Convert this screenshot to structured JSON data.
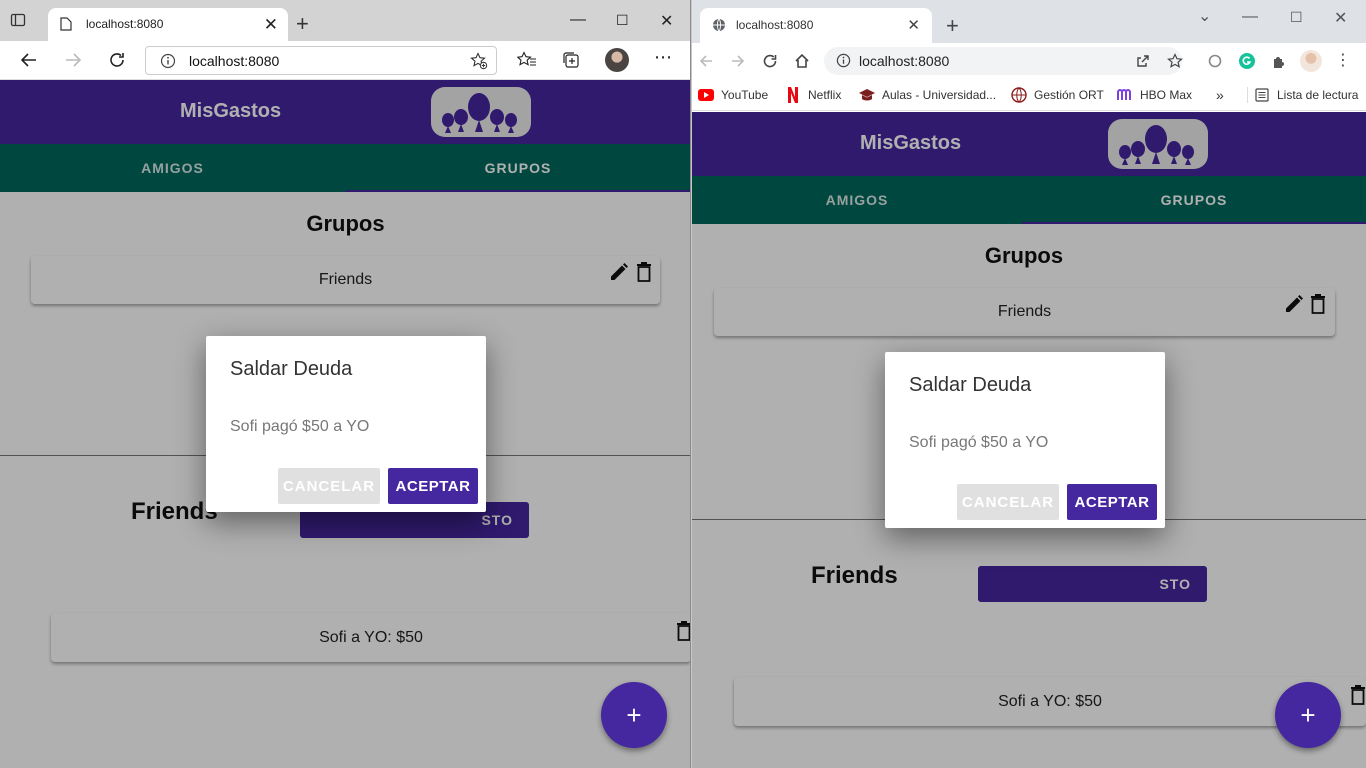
{
  "colors": {
    "primary": "#4527a0",
    "tabs_bar": "#00695c",
    "overlay": "rgba(0,0,0,0.31)"
  },
  "left_window": {
    "browser": "Edge",
    "tab_title": "localhost:8080",
    "url": "localhost:8080",
    "icons": [
      "tab-actions-icon",
      "page-icon",
      "close-icon",
      "new-tab-icon",
      "minimize-icon",
      "maximize-icon",
      "window-close-icon",
      "back-icon",
      "forward-icon",
      "refresh-icon",
      "info-icon",
      "add-favorite-icon",
      "favorites-icon",
      "collections-icon",
      "profile-avatar",
      "more-icon"
    ]
  },
  "right_window": {
    "browser": "Chrome",
    "tab_title": "localhost:8080",
    "url": "localhost:8080",
    "bookmarks": [
      {
        "label": "YouTube",
        "icon": "youtube-icon"
      },
      {
        "label": "Netflix",
        "icon": "netflix-icon"
      },
      {
        "label": "Aulas - Universidad...",
        "icon": "graduation-cap-icon"
      },
      {
        "label": "Gestión ORT",
        "icon": "globe-icon"
      },
      {
        "label": "HBO Max",
        "icon": "hbo-icon"
      }
    ],
    "more_bookmarks": "»",
    "reading_list": "Lista de lectura"
  },
  "app": {
    "brand": "MisGastos",
    "tabs": [
      "AMIGOS",
      "GRUPOS"
    ],
    "active_tab": "GRUPOS",
    "groups_title": "Grupos",
    "group_card": "Friends",
    "group_header": "Friends",
    "add_gasto_label": "AGREGAR GASTO",
    "add_gasto_visible": "STO",
    "debt_card": "Sofi a YO: $50",
    "fab_label": "+"
  },
  "dialog": {
    "title": "Saldar Deuda",
    "body": "Sofi pagó $50 a YO",
    "cancel": "CANCELAR",
    "accept": "ACEPTAR"
  }
}
